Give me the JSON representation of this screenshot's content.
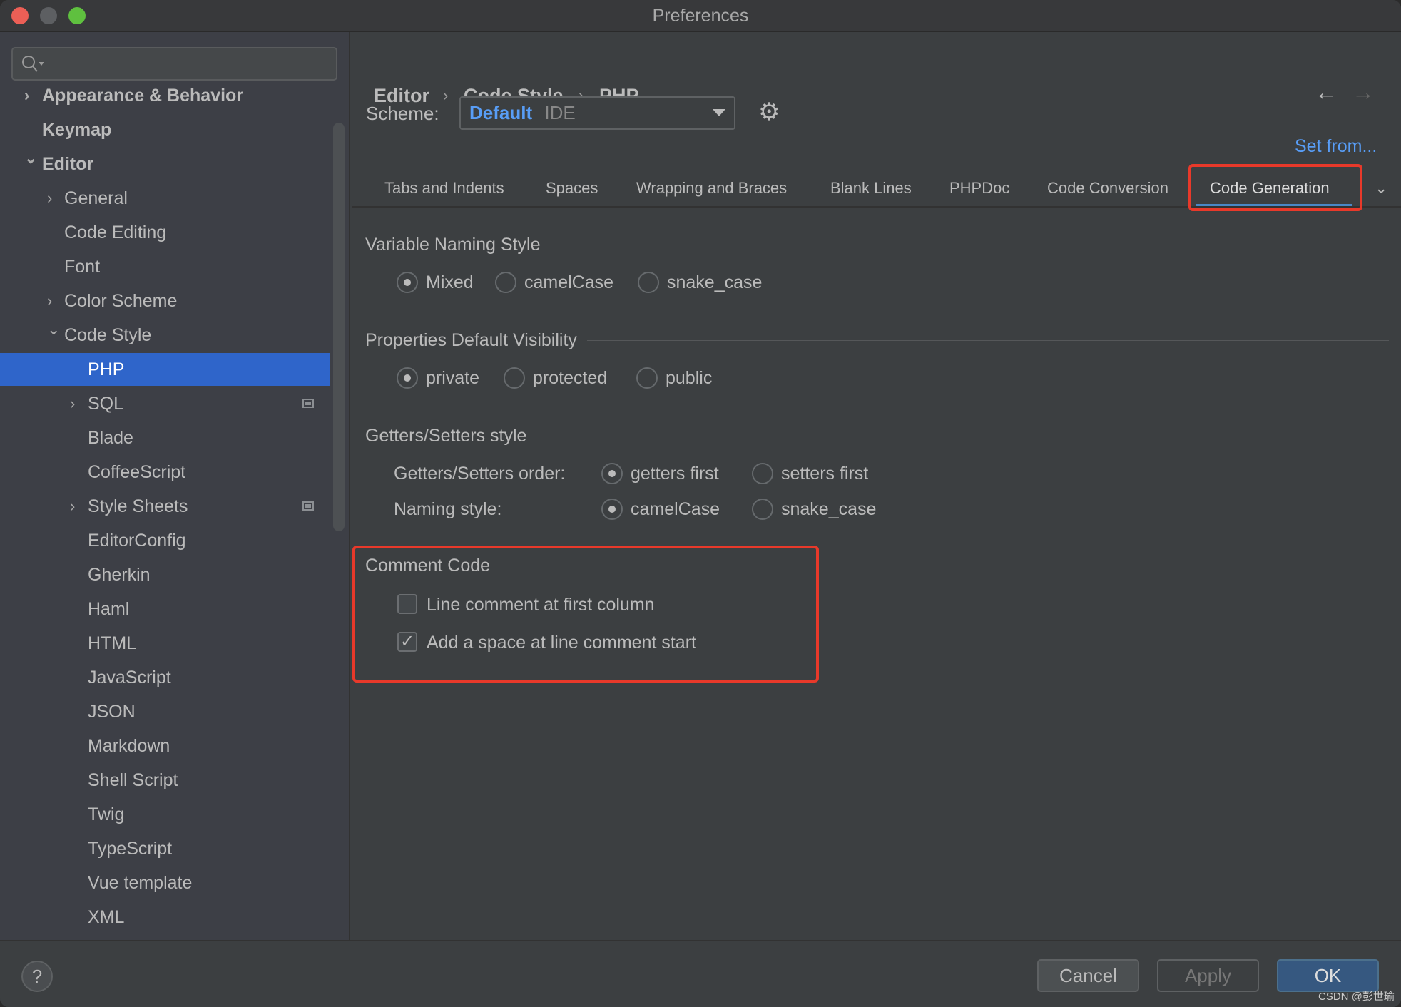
{
  "window": {
    "title": "Preferences"
  },
  "search": {
    "placeholder": ""
  },
  "sidebar": {
    "items": [
      {
        "label": "Appearance & Behavior",
        "level": 0,
        "bold": true,
        "arrow": "right"
      },
      {
        "label": "Keymap",
        "level": 0,
        "bold": true
      },
      {
        "label": "Editor",
        "level": 0,
        "bold": true,
        "arrow": "down"
      },
      {
        "label": "General",
        "level": 1,
        "arrow": "right"
      },
      {
        "label": "Code Editing",
        "level": 1
      },
      {
        "label": "Font",
        "level": 1
      },
      {
        "label": "Color Scheme",
        "level": 1,
        "arrow": "right"
      },
      {
        "label": "Code Style",
        "level": 1,
        "arrow": "down"
      },
      {
        "label": "PHP",
        "level": 2,
        "selected": true
      },
      {
        "label": "SQL",
        "level": 2,
        "arrow": "right",
        "badge": true
      },
      {
        "label": "Blade",
        "level": 2
      },
      {
        "label": "CoffeeScript",
        "level": 2
      },
      {
        "label": "Style Sheets",
        "level": 2,
        "arrow": "right",
        "badge": true
      },
      {
        "label": "EditorConfig",
        "level": 2
      },
      {
        "label": "Gherkin",
        "level": 2
      },
      {
        "label": "Haml",
        "level": 2
      },
      {
        "label": "HTML",
        "level": 2
      },
      {
        "label": "JavaScript",
        "level": 2
      },
      {
        "label": "JSON",
        "level": 2
      },
      {
        "label": "Markdown",
        "level": 2
      },
      {
        "label": "Shell Script",
        "level": 2
      },
      {
        "label": "Twig",
        "level": 2
      },
      {
        "label": "TypeScript",
        "level": 2
      },
      {
        "label": "Vue template",
        "level": 2
      },
      {
        "label": "XML",
        "level": 2
      }
    ]
  },
  "breadcrumb": [
    "Editor",
    "Code Style",
    "PHP"
  ],
  "scheme": {
    "label": "Scheme:",
    "name": "Default",
    "type": "IDE",
    "set_from": "Set from..."
  },
  "tabs": [
    {
      "label": "Tabs and Indents"
    },
    {
      "label": "Spaces"
    },
    {
      "label": "Wrapping and Braces"
    },
    {
      "label": "Blank Lines"
    },
    {
      "label": "PHPDoc"
    },
    {
      "label": "Code Conversion"
    },
    {
      "label": "Code Generation",
      "active": true
    }
  ],
  "sections": {
    "variable": {
      "title": "Variable Naming Style",
      "options": [
        "Mixed",
        "camelCase",
        "snake_case"
      ],
      "selected": "Mixed"
    },
    "visibility": {
      "title": "Properties Default Visibility",
      "options": [
        "private",
        "protected",
        "public"
      ],
      "selected": "private"
    },
    "getters": {
      "title": "Getters/Setters style",
      "order_label": "Getters/Setters order:",
      "order_options": [
        "getters first",
        "setters first"
      ],
      "order_selected": "getters first",
      "naming_label": "Naming style:",
      "naming_options": [
        "camelCase",
        "snake_case"
      ],
      "naming_selected": "camelCase"
    },
    "comment": {
      "title": "Comment Code",
      "line_comment": {
        "label": "Line comment at first column",
        "checked": false
      },
      "add_space": {
        "label": "Add a space at line comment start",
        "checked": true
      }
    }
  },
  "buttons": {
    "cancel": "Cancel",
    "apply": "Apply",
    "ok": "OK",
    "help": "?"
  },
  "watermark": "CSDN @彭世瑜",
  "colors": {
    "accent": "#2f65ca",
    "link": "#589df6",
    "highlight": "#e8392a",
    "ok": "#365880"
  }
}
